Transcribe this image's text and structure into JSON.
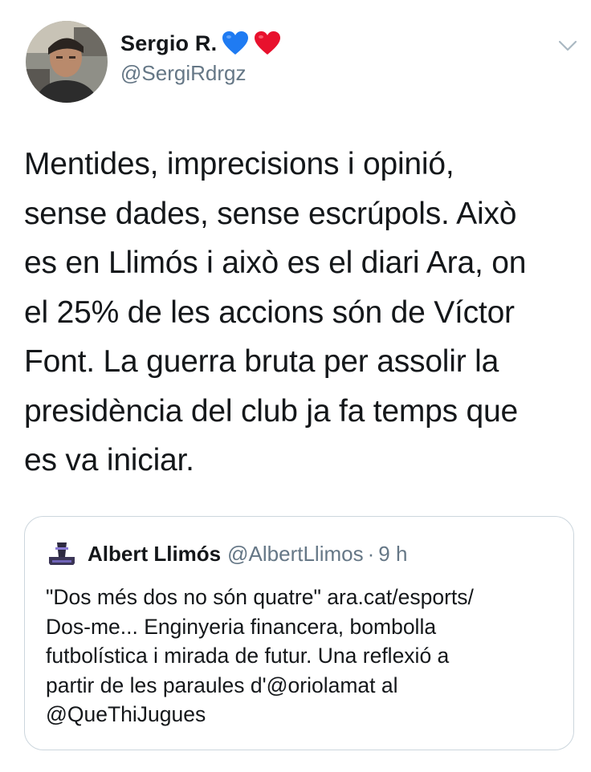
{
  "tweet": {
    "author": {
      "display_name": "Sergio R.",
      "handle": "@SergiRdrgz",
      "name_emojis": [
        "blue-heart-icon",
        "red-heart-icon"
      ]
    },
    "text": "Mentides, imprecisions i opinió,\nsense dades, sense escrúpols. Això\nes en Llimós i això es el diari Ara, on\nel 25% de les accions són de Víctor\nFont. La guerra bruta per assolir la\npresidència del club ja fa temps que\nes va iniciar.",
    "menu_icon": "chevron-down-icon"
  },
  "quoted_tweet": {
    "author": {
      "display_name": "Albert Llimós",
      "handle": "@AlbertLlimos",
      "separator": "·",
      "time": "9 h"
    },
    "text": "\"Dos més dos no són quatre\" ara.cat/esports/\nDos-me... Enginyeria financera, bombolla\nfutbolística i mirada de futur. Una reflexió a\npartir de les paraules d'@oriolamat al\n@QueThiJugues"
  },
  "colors": {
    "text_primary": "#14171a",
    "text_secondary": "#657786",
    "border": "#ccd6dd",
    "blue_heart": "#1f7bf2",
    "red_heart": "#e8112d"
  }
}
